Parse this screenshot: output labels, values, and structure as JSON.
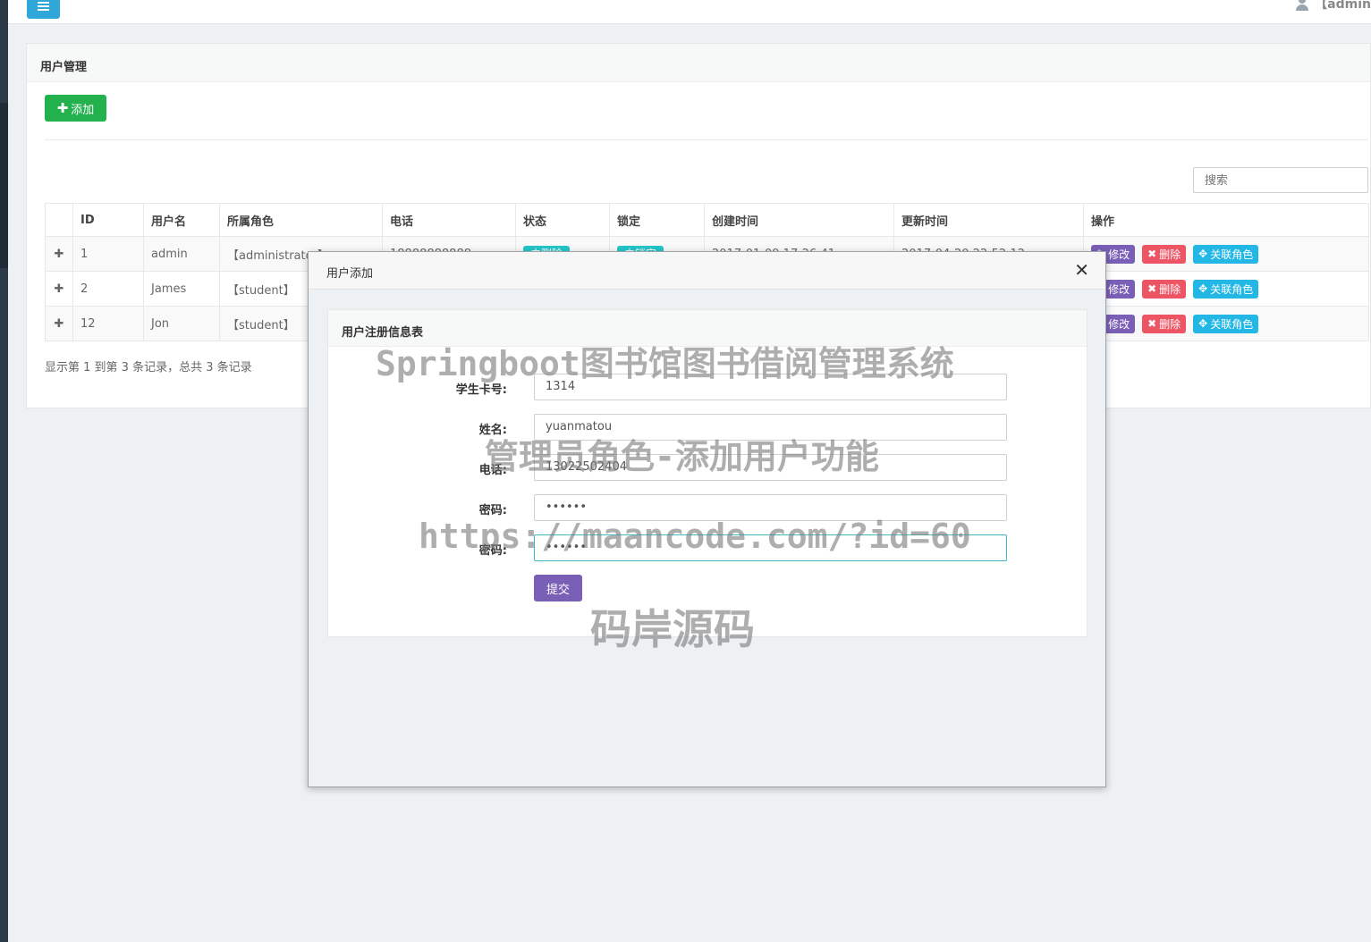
{
  "header": {
    "user_name": "【admin"
  },
  "panel": {
    "title": "用户管理",
    "add_button": "添加",
    "search_placeholder": "搜索",
    "table": {
      "columns": [
        "",
        "ID",
        "用户名",
        "所属角色",
        "电话",
        "状态",
        "锁定",
        "创建时间",
        "更新时间",
        "操作"
      ],
      "rows": [
        {
          "id": "1",
          "username": "admin",
          "role": "【administrator】",
          "phone": "18888888888",
          "status": "未删除",
          "lock": "未锁定",
          "created": "2017-01-09 17:26:41",
          "updated": "2017-04-20 22:52:12"
        },
        {
          "id": "2",
          "username": "James",
          "role": "【student】",
          "phone": "",
          "status": "",
          "lock": "",
          "created": "",
          "updated": ""
        },
        {
          "id": "12",
          "username": "Jon",
          "role": "【student】",
          "phone": "",
          "status": "",
          "lock": "",
          "created": "",
          "updated": ""
        }
      ],
      "actions": {
        "edit": "修改",
        "delete": "删除",
        "role": "关联角色"
      }
    },
    "footer": "显示第 1 到第 3 条记录，总共 3 条记录"
  },
  "modal": {
    "title": "用户添加",
    "form_title": "用户注册信息表",
    "fields": [
      {
        "label": "学生卡号:",
        "value": "1314"
      },
      {
        "label": "姓名:",
        "value": "yuanmatou"
      },
      {
        "label": "电话:",
        "value": "13022502404"
      },
      {
        "label": "密码:",
        "value": "••••••"
      },
      {
        "label": "密码:",
        "value": "••••••"
      }
    ],
    "submit": "提交"
  },
  "watermark": {
    "line1": "Springboot图书馆图书借阅管理系统",
    "line2": "管理员角色-添加用户功能",
    "line3": "https://maancode.com/?id=60",
    "line4": "码岸源码"
  },
  "colors": {
    "add_green": "#23b14d",
    "edit_purple": "#7a5fb6",
    "delete_red": "#ed5565",
    "role_blue": "#23b7e5",
    "badge_teal": "#23c6c8",
    "menu_blue": "#2fa7d8"
  },
  "icons": [
    "menu-icon",
    "user-icon",
    "plus-icon",
    "expand-plus-icon",
    "edit-icon",
    "delete-icon",
    "move-icon",
    "close-icon"
  ]
}
